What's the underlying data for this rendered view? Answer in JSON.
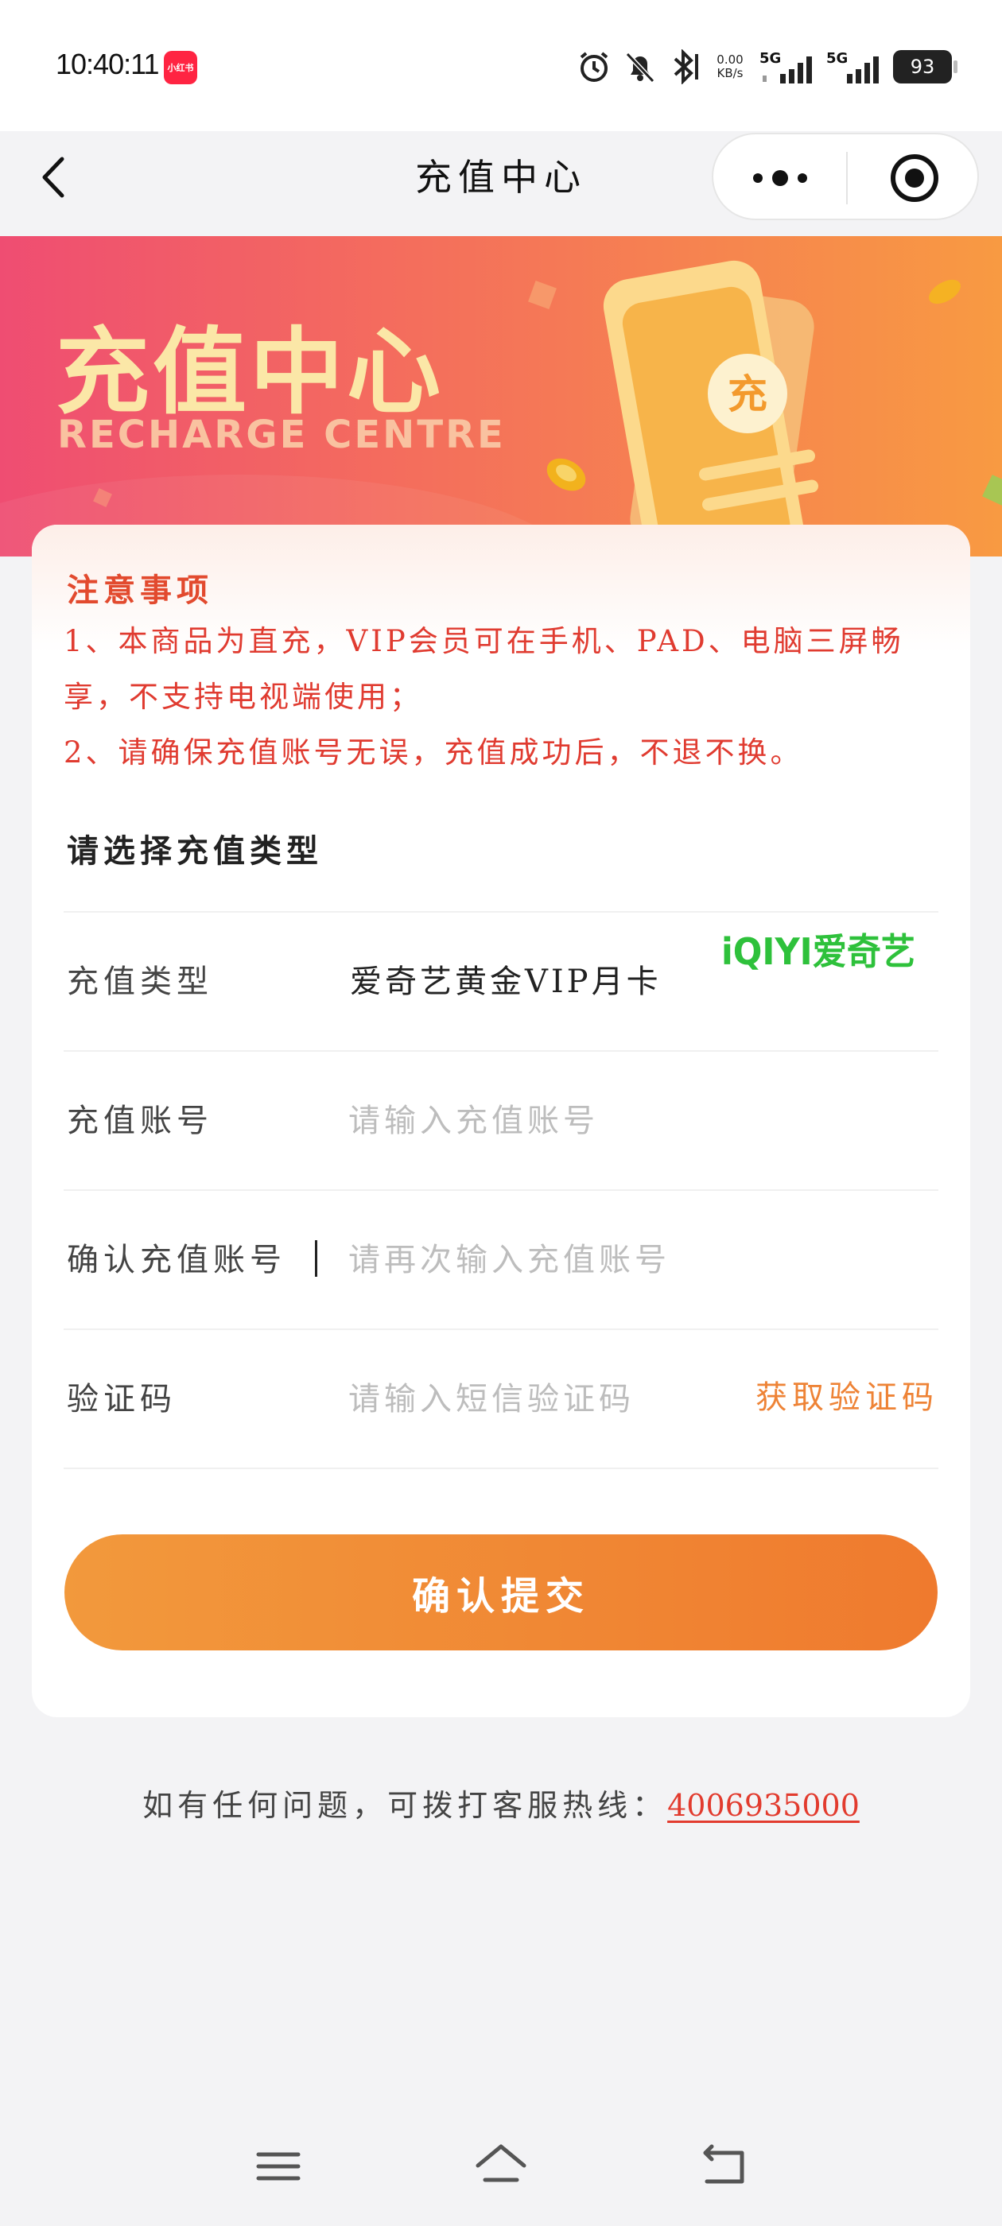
{
  "status_bar": {
    "time": "10:40:11",
    "app_badge": "小红书",
    "net_speed_value": "0.00",
    "net_speed_unit": "KB/s",
    "signal1": "5G",
    "signal2": "5G",
    "battery": "93"
  },
  "nav": {
    "title": "充值中心"
  },
  "banner": {
    "title": "充值中心",
    "subtitle": "RECHARGE CENTRE",
    "phone_char": "充"
  },
  "notice": {
    "title": "注意事项",
    "line1a": "1、本商品为直充，VIP会员可在手机、PAD、电脑三屏畅",
    "line1b": "享，不支持电视端使用；",
    "line2": "2、请确保充值账号无误，充值成功后，不退不换。"
  },
  "form": {
    "section_title": "请选择充值类型",
    "type_label": "充值类型",
    "type_value": "爱奇艺黄金VIP月卡",
    "brand_logo": "iQIYI爱奇艺",
    "account_label": "充值账号",
    "account_placeholder": "请输入充值账号",
    "confirm_label": "确认充值账号",
    "confirm_placeholder": "请再次输入充值账号",
    "code_label": "验证码",
    "code_placeholder": "请输入短信验证码",
    "get_code": "获取验证码",
    "submit": "确认提交"
  },
  "footer": {
    "hotline_text": "如有任何问题，可拨打客服热线：",
    "hotline_number": "4006935000"
  },
  "colors": {
    "accent_orange": "#ef7a2e",
    "notice_red": "#e03b30",
    "iqiyi_green": "#2ec13b"
  }
}
